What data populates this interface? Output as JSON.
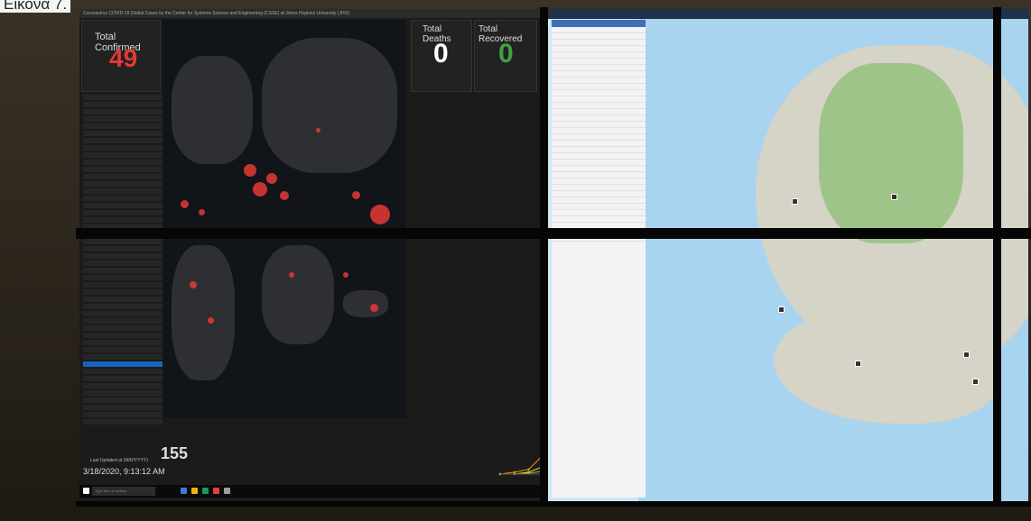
{
  "caption": "Εικόνα 7.",
  "dashboard": {
    "title": "Coronavirus COVID-19 Global Cases by the Center for Systems Science and Engineering (CSSE) at Johns Hopkins University (JHU)",
    "total_confirmed_label": "Total Confirmed",
    "total_confirmed_value": "49",
    "total_deaths_label": "Total Deaths",
    "total_deaths_value": "0",
    "total_recovered_label": "Total Recovered",
    "total_recovered_value": "0",
    "countries_count": "155",
    "countries_label": "countries/regions",
    "updated_label": "Last Updated at (M/D/YYYY)",
    "updated_value": "3/18/2020, 9:13:12 AM",
    "search_placeholder": "Type here to search",
    "colors": {
      "confirmed": "#e53935",
      "deaths": "#ffffff",
      "recovered": "#43a047"
    }
  },
  "chart_data": {
    "type": "line",
    "series": [
      {
        "name": "",
        "color": "#ff9800",
        "values": [
          0,
          2,
          5,
          20,
          60,
          95,
          100,
          100,
          100
        ]
      },
      {
        "name": "",
        "color": "#ffeb3b",
        "values": [
          0,
          0,
          2,
          8,
          25,
          55,
          85,
          100,
          150
        ]
      },
      {
        "name": "",
        "color": "#8bc34a",
        "values": [
          0,
          0,
          1,
          3,
          10,
          30,
          60,
          90,
          100
        ]
      }
    ]
  }
}
